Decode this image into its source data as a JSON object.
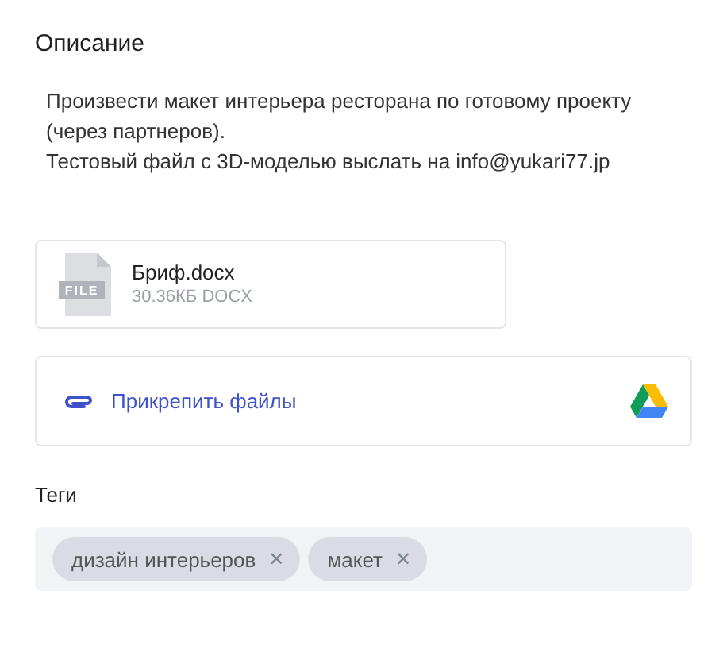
{
  "description": {
    "title": "Описание",
    "paragraphs": [
      "Произвести макет интерьера ресторана по готовому проекту (через партнеров).",
      "Тестовый файл с 3D-моделью выслать на info@yukari77.jp"
    ]
  },
  "attachments": [
    {
      "icon_label": "FILE",
      "name": "Бриф.docx",
      "meta": "30.36КБ DOCX"
    }
  ],
  "attach": {
    "label": "Прикрепить файлы"
  },
  "tags": {
    "title": "Теги",
    "items": [
      {
        "label": "дизайн интерьеров",
        "remove": "✕"
      },
      {
        "label": "макет",
        "remove": "✕"
      }
    ]
  }
}
